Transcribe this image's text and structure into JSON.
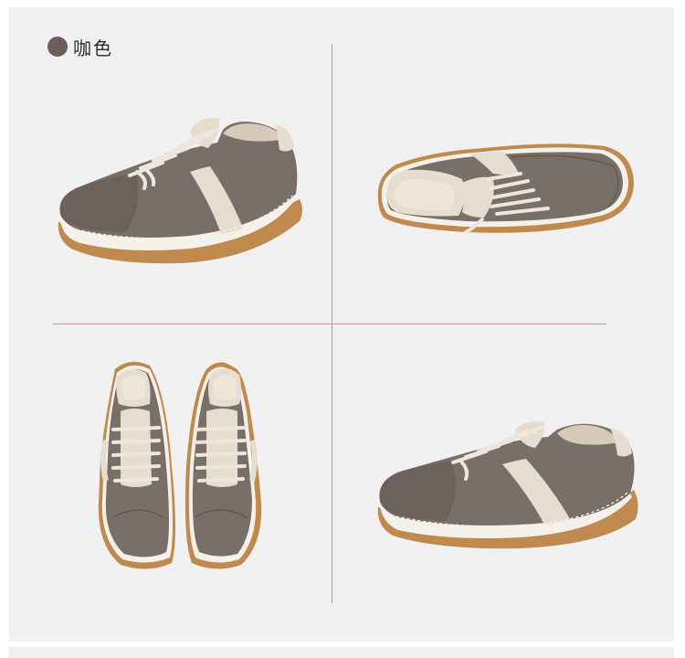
{
  "color_label": {
    "text": "咖色",
    "swatch_color": "#6b5d57"
  },
  "palette": {
    "suede": "#7a6e68",
    "suede_dark": "#5e534e",
    "cream": "#e6ddd0",
    "sole_white": "#f4f1ea",
    "gum": "#c08a4e",
    "lace": "#ece6dc"
  },
  "views": [
    {
      "name": "side-view-left",
      "icon": "sneaker-side-icon"
    },
    {
      "name": "top-angle-view",
      "icon": "sneaker-top-angle-icon"
    },
    {
      "name": "front-pair-view",
      "icon": "sneaker-pair-front-icon"
    },
    {
      "name": "side-view-right",
      "icon": "sneaker-side-icon"
    }
  ]
}
